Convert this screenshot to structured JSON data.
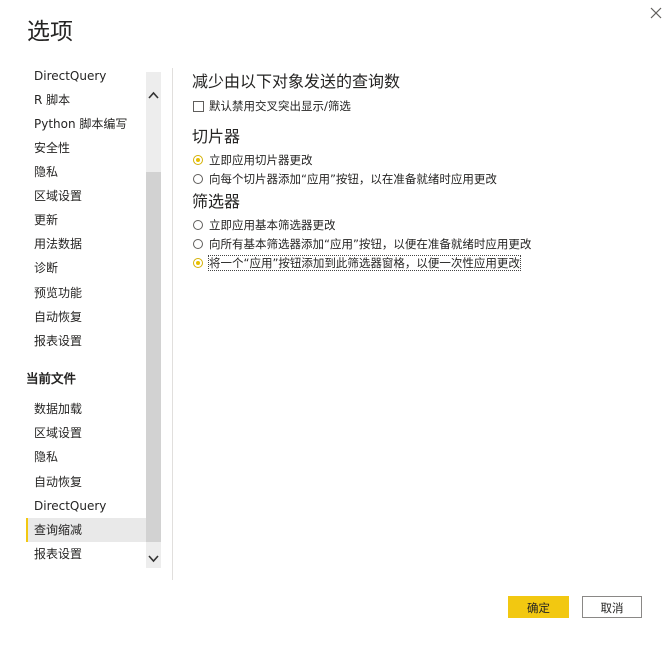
{
  "dialog": {
    "title": "选项",
    "close_icon": "close-icon"
  },
  "sidebar": {
    "global_items": [
      {
        "label": "DirectQuery"
      },
      {
        "label": "R 脚本"
      },
      {
        "label": "Python 脚本编写"
      },
      {
        "label": "安全性"
      },
      {
        "label": "隐私"
      },
      {
        "label": "区域设置"
      },
      {
        "label": "更新"
      },
      {
        "label": "用法数据"
      },
      {
        "label": "诊断"
      },
      {
        "label": "预览功能"
      },
      {
        "label": "自动恢复"
      },
      {
        "label": "报表设置"
      }
    ],
    "current_file_header": "当前文件",
    "current_file_items": [
      {
        "label": "数据加载"
      },
      {
        "label": "区域设置"
      },
      {
        "label": "隐私"
      },
      {
        "label": "自动恢复"
      },
      {
        "label": "DirectQuery"
      },
      {
        "label": "查询缩减",
        "selected": true
      },
      {
        "label": "报表设置"
      }
    ],
    "selected": "查询缩减"
  },
  "content": {
    "reduce_heading": "减少由以下对象发送的查询数",
    "disable_cross_highlight": {
      "label": "默认禁用交叉突出显示/筛选",
      "checked": false
    },
    "slicers_heading": "切片器",
    "slicer_options": [
      {
        "label": "立即应用切片器更改",
        "checked": true
      },
      {
        "label": "向每个切片器添加“应用”按钮，以在准备就绪时应用更改",
        "checked": false
      }
    ],
    "filters_heading": "筛选器",
    "filter_options": [
      {
        "label": "立即应用基本筛选器更改",
        "checked": false
      },
      {
        "label": "向所有基本筛选器添加“应用”按钮，以便在准备就绪时应用更改",
        "checked": false
      },
      {
        "label": "将一个“应用”按钮添加到此筛选器窗格，以便一次性应用更改",
        "checked": true
      }
    ]
  },
  "footer": {
    "ok_label": "确定",
    "cancel_label": "取消"
  },
  "colors": {
    "accent": "#f2c811",
    "selected_bg": "#e9e9e9",
    "text": "#252423"
  }
}
